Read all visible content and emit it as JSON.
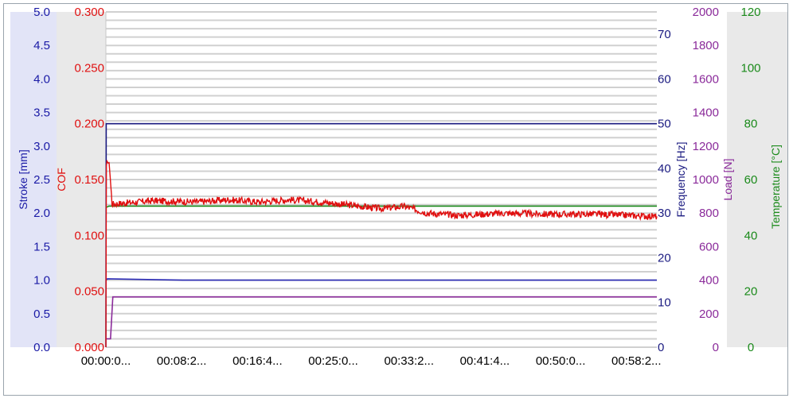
{
  "chart_data": {
    "type": "line",
    "x_ticks": [
      "00:00:0...",
      "00:08:2...",
      "00:16:4...",
      "00:25:0...",
      "00:33:2...",
      "00:41:4...",
      "00:50:0...",
      "00:58:2..."
    ],
    "x_range_s": [
      0,
      3600
    ],
    "grid": true,
    "axes": {
      "stroke": {
        "label": "Stroke [mm]",
        "color": "#1a1aa6",
        "range": [
          0,
          5
        ],
        "ticks": [
          "0.0",
          "0.5",
          "1.0",
          "1.5",
          "2.0",
          "2.5",
          "3.0",
          "3.5",
          "4.0",
          "4.5",
          "5.0"
        ]
      },
      "cof": {
        "label": "COF",
        "color": "#e01010",
        "range": [
          0,
          0.3
        ],
        "ticks": [
          "0.000",
          "0.050",
          "0.100",
          "0.150",
          "0.200",
          "0.250",
          "0.300"
        ]
      },
      "frequency": {
        "label": "Frequency [Hz]",
        "color": "#1a1a80",
        "range": [
          0,
          75
        ],
        "ticks": [
          "0",
          "10",
          "20",
          "30",
          "40",
          "50",
          "60",
          "70"
        ]
      },
      "load": {
        "label": "Load [N]",
        "color": "#8a2a9a",
        "range": [
          0,
          2000
        ],
        "ticks": [
          "0",
          "200",
          "400",
          "600",
          "800",
          "1000",
          "1200",
          "1400",
          "1600",
          "1800",
          "2000"
        ]
      },
      "temperature": {
        "label": "Temperature [°C]",
        "color": "#1a8a1a",
        "range": [
          0,
          120
        ],
        "ticks": [
          "0",
          "20",
          "40",
          "60",
          "80",
          "100",
          "120"
        ]
      }
    },
    "series": [
      {
        "axis": "frequency",
        "color": "#1a1a80",
        "points": [
          [
            0,
            0
          ],
          [
            2,
            50
          ],
          [
            3600,
            50
          ]
        ]
      },
      {
        "axis": "temperature",
        "color": "#1a8a1a",
        "points": [
          [
            0,
            50
          ],
          [
            20,
            50.5
          ],
          [
            3600,
            50.5
          ]
        ]
      },
      {
        "axis": "stroke",
        "color": "#2a2ab5",
        "points": [
          [
            0,
            1.0
          ],
          [
            10,
            1.02
          ],
          [
            500,
            1.0
          ],
          [
            1000,
            1.0
          ],
          [
            2000,
            1.0
          ],
          [
            3000,
            1.0
          ],
          [
            3600,
            1.0
          ]
        ]
      },
      {
        "axis": "load",
        "color": "#8a2a9a",
        "points": [
          [
            0,
            50
          ],
          [
            30,
            50
          ],
          [
            45,
            300
          ],
          [
            3600,
            300
          ]
        ]
      },
      {
        "axis": "cof",
        "color": "#e01010",
        "points": [
          [
            0,
            0.0
          ],
          [
            3,
            0.16
          ],
          [
            12,
            0.168
          ],
          [
            25,
            0.16
          ],
          [
            40,
            0.128
          ],
          [
            300,
            0.131
          ],
          [
            600,
            0.13
          ],
          [
            800,
            0.132
          ],
          [
            1000,
            0.13
          ],
          [
            1200,
            0.132
          ],
          [
            1400,
            0.13
          ],
          [
            1600,
            0.127
          ],
          [
            1800,
            0.124
          ],
          [
            1950,
            0.126
          ],
          [
            2100,
            0.12
          ],
          [
            2300,
            0.118
          ],
          [
            2600,
            0.12
          ],
          [
            2900,
            0.119
          ],
          [
            3200,
            0.119
          ],
          [
            3600,
            0.117
          ]
        ]
      }
    ]
  }
}
